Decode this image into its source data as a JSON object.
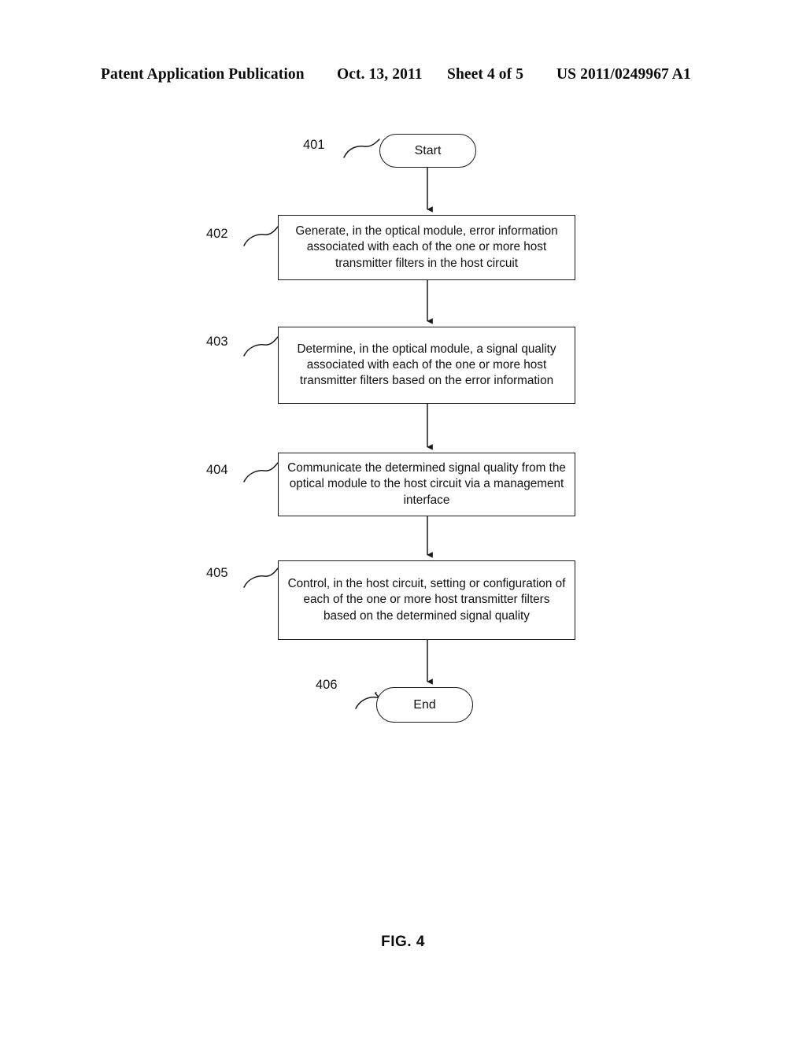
{
  "header": {
    "publication": "Patent Application Publication",
    "date": "Oct. 13, 2011",
    "sheet": "Sheet 4 of 5",
    "patent_number": "US 2011/0249967 A1"
  },
  "figure": {
    "caption": "FIG. 4"
  },
  "flowchart": {
    "nodes": [
      {
        "ref": "401",
        "type": "terminator",
        "label": "Start"
      },
      {
        "ref": "402",
        "type": "process",
        "label": "Generate, in the optical module, error information associated with each of the one or more host transmitter filters in the host circuit"
      },
      {
        "ref": "403",
        "type": "process",
        "label": "Determine, in the optical module, a signal quality associated with each of the one or more host transmitter filters based on the error information"
      },
      {
        "ref": "404",
        "type": "process",
        "label": "Communicate the determined signal quality from the optical module to the host circuit via a management interface"
      },
      {
        "ref": "405",
        "type": "process",
        "label": "Control, in the host circuit, setting or configuration of each of the one or more host transmitter filters based on the determined signal quality"
      },
      {
        "ref": "406",
        "type": "terminator",
        "label": "End"
      }
    ],
    "colors": {
      "stroke": "#1a1a1a",
      "fill": "#ffffff",
      "text": "#111111"
    }
  }
}
